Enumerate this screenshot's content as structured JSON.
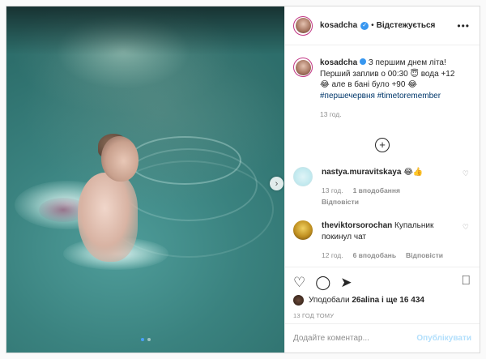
{
  "post": {
    "username": "kosadcha",
    "follow_status": "Відстежується",
    "more_icon": "more-horizontal-icon"
  },
  "caption": {
    "username": "kosadcha",
    "text_1": "З першим днем літа!",
    "text_2": "Перший заплив о 00:30",
    "text_3": "вода +12",
    "text_4": "але в бані було +90",
    "hashtags": "#першечервня #timetoremember",
    "time": "13 год."
  },
  "load_more_icon": "plus-circle-icon",
  "comments": [
    {
      "username": "nastya.muravitskaya",
      "text": "😂👍",
      "time": "13 год.",
      "likes": "1 вподобання",
      "reply": "Відповісти"
    },
    {
      "username": "theviktorsorochan",
      "text": "Купальник покинул чат",
      "time": "12 год.",
      "likes": "6 вподобань",
      "reply": "Відповісти"
    }
  ],
  "likes": {
    "prefix": "Уподобали",
    "first_user": "26alina",
    "suffix": "і ще 16 434"
  },
  "timestamp": "13 ГОД ТОМУ",
  "add_comment": {
    "placeholder": "Додайте коментар...",
    "publish_label": "Опублікувати"
  },
  "carousel": {
    "total_slides": 2,
    "current_slide": 1
  },
  "colors": {
    "verified": "#3897f0",
    "hashtag": "#00376b",
    "publish_disabled": "#b2dffc",
    "active_dot": "#4aa0ff"
  }
}
